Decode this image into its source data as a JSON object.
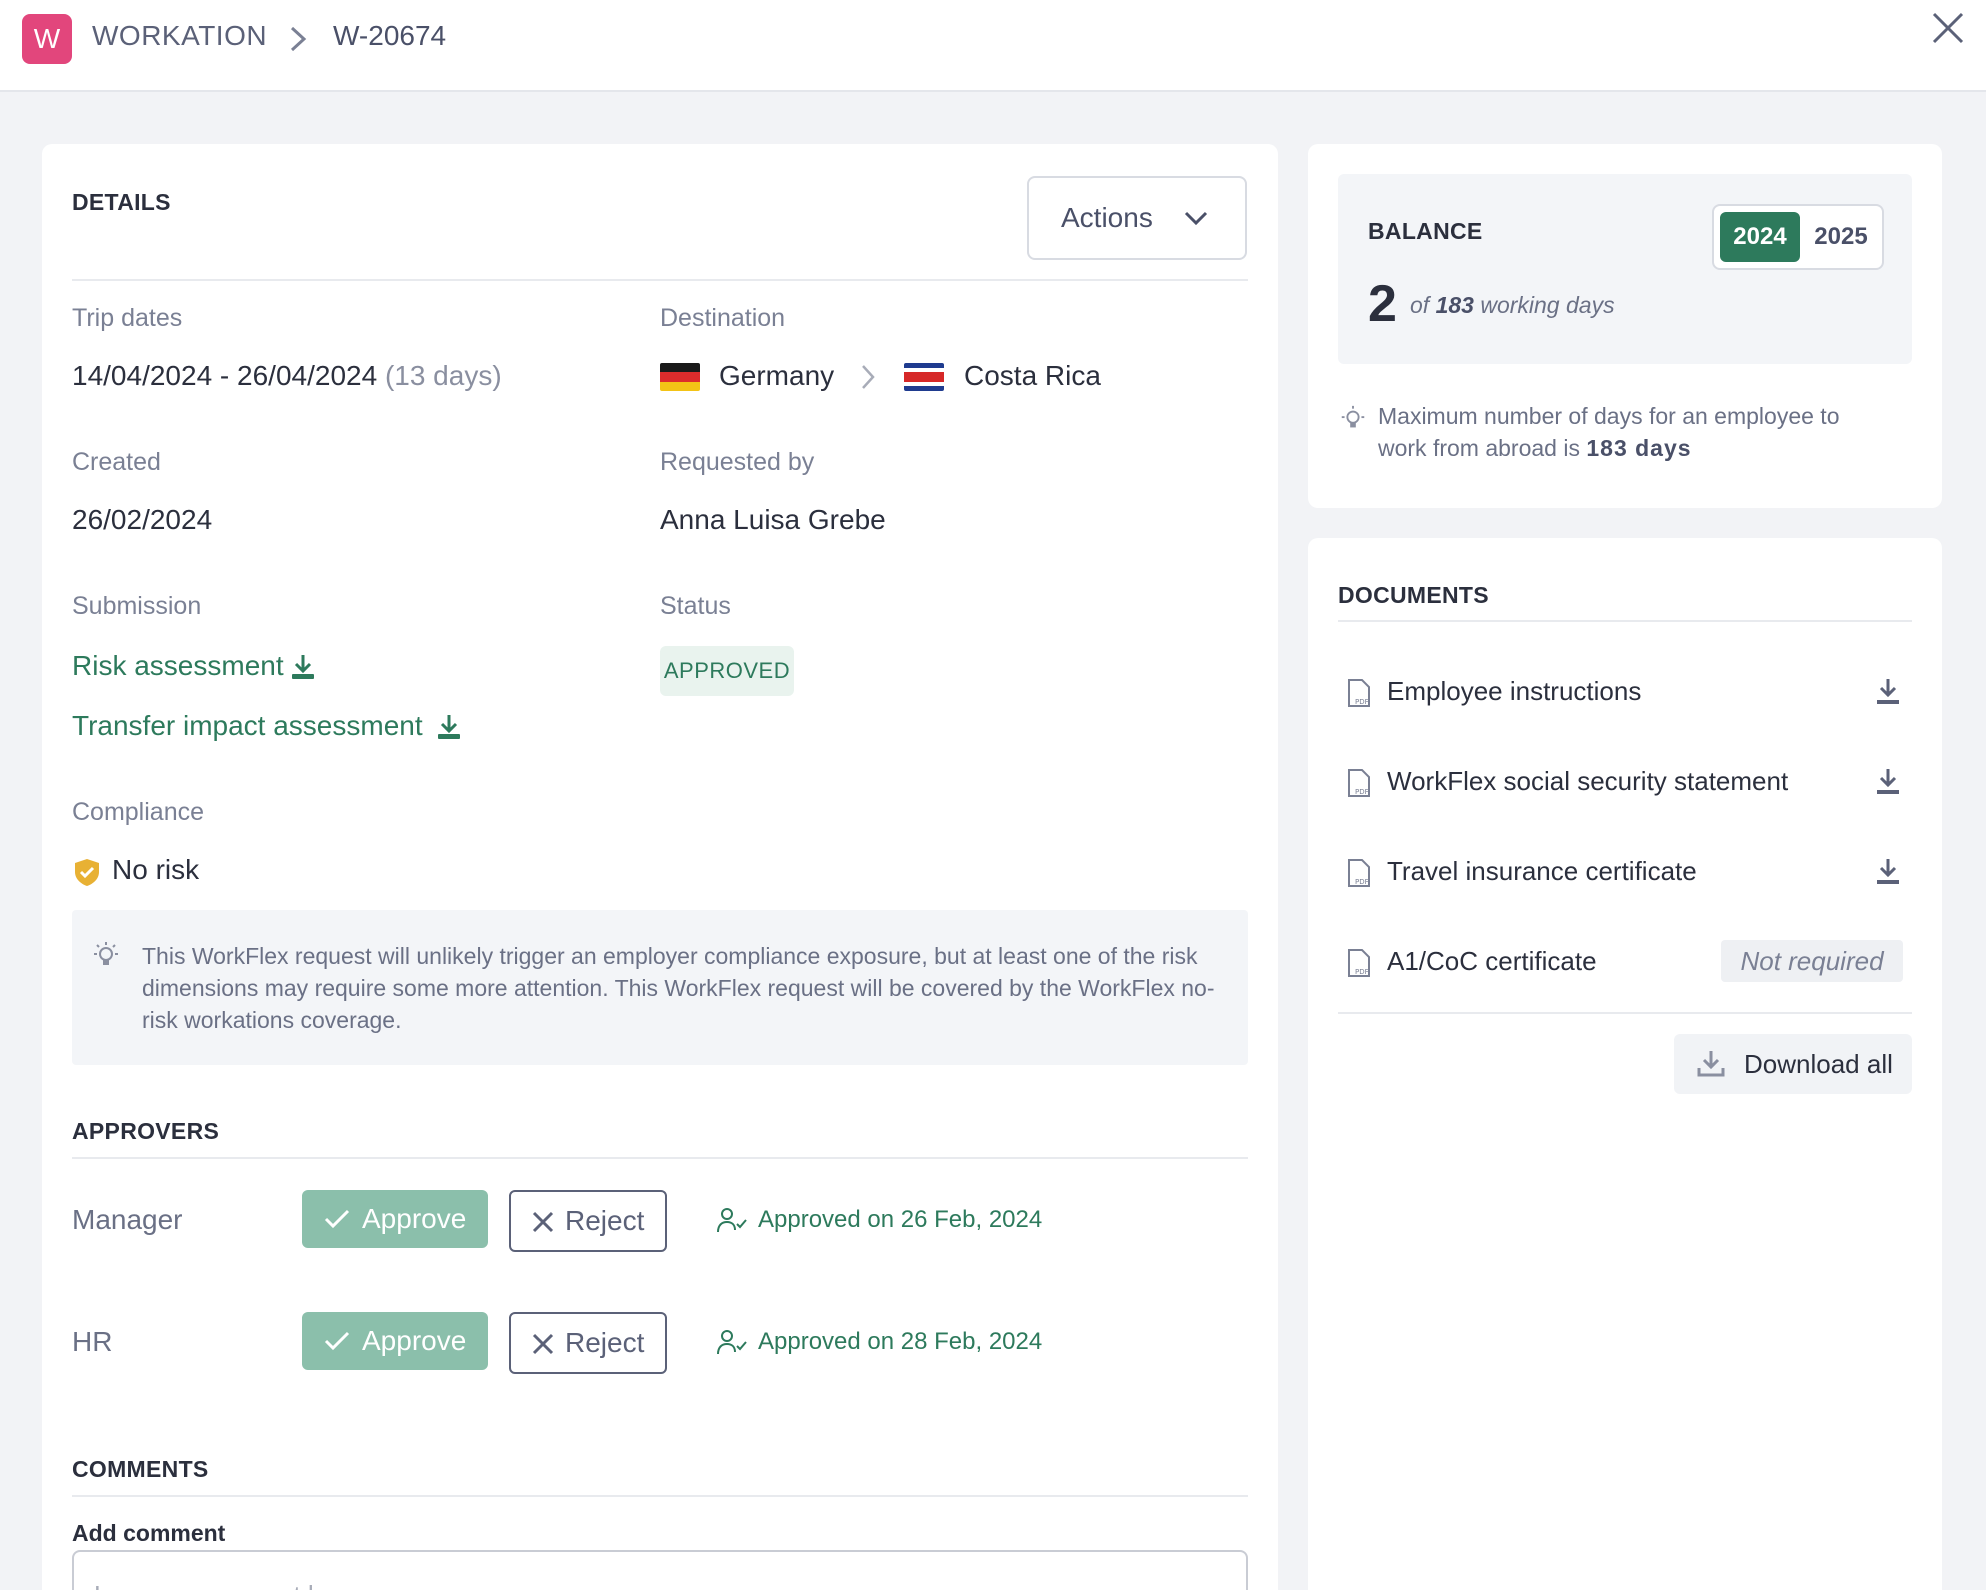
{
  "header": {
    "logo_letter": "W",
    "breadcrumb_section": "WORKATION",
    "breadcrumb_id": "W-20674"
  },
  "details": {
    "title": "DETAILS",
    "actions_label": "Actions",
    "trip_dates_label": "Trip dates",
    "trip_dates_value": "14/04/2024 - 26/04/2024",
    "trip_days": "(13 days)",
    "destination_label": "Destination",
    "origin_country": "Germany",
    "destination_country": "Costa Rica",
    "created_label": "Created",
    "created_value": "26/02/2024",
    "requested_by_label": "Requested by",
    "requested_by_value": "Anna Luisa Grebe",
    "submission_label": "Submission",
    "risk_assessment_link": "Risk assessment",
    "transfer_assessment_link": "Transfer impact assessment",
    "status_label": "Status",
    "status_value": "APPROVED",
    "compliance_label": "Compliance",
    "compliance_value": "No risk",
    "compliance_note": "This WorkFlex request will unlikely trigger an employer compliance exposure, but at least one of the risk dimensions may require some more attention. This WorkFlex request will be covered by the WorkFlex no-risk workations coverage."
  },
  "approvers": {
    "title": "APPROVERS",
    "approve_label": "Approve",
    "reject_label": "Reject",
    "rows": [
      {
        "role": "Manager",
        "note": "Approved on 26 Feb, 2024"
      },
      {
        "role": "HR",
        "note": "Approved on 28 Feb, 2024"
      }
    ]
  },
  "comments": {
    "title": "COMMENTS",
    "add_label": "Add comment",
    "placeholder": "Leave a comment here"
  },
  "balance": {
    "title": "BALANCE",
    "years": [
      "2024",
      "2025"
    ],
    "selected_year": "2024",
    "used_days": "2",
    "of_prefix": "of",
    "total_days": "183",
    "of_suffix": "working days",
    "hint_line1": "Maximum number of days for an employee to",
    "hint_line2_prefix": "work from abroad is",
    "hint_days": "183 days"
  },
  "documents": {
    "title": "DOCUMENTS",
    "items": [
      {
        "name": "Employee instructions"
      },
      {
        "name": "WorkFlex social security statement"
      },
      {
        "name": "Travel insurance certificate"
      },
      {
        "name": "A1/CoC certificate",
        "status": "Not required"
      }
    ],
    "download_all_label": "Download all"
  },
  "colors": {
    "brand": "#e2467c",
    "accent_green": "#2d7a5c",
    "approve_button": "#8bbfab"
  }
}
